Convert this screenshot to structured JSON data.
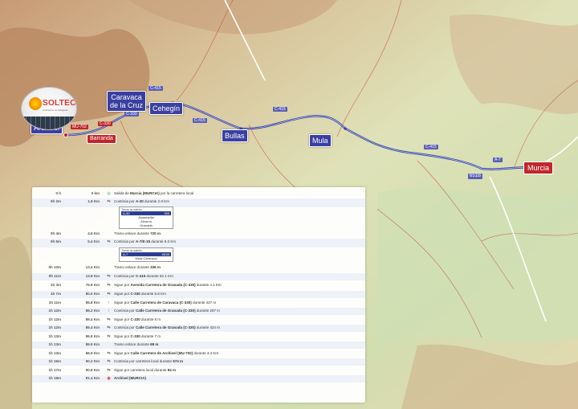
{
  "map": {
    "towns": {
      "caravaca": "Caravaca\nde la Cruz",
      "cehegin": "Cehegín",
      "bullas": "Bullas",
      "mula": "Mula",
      "murcia": "Murcia",
      "archivel": "Archivel",
      "barranda": "Barranda"
    },
    "roads": {
      "c415_a": "C-415",
      "c415_b": "C-415",
      "c415_c": "C-415",
      "c415_d": "C-415",
      "c330_a": "C-330",
      "c330_b": "C-330",
      "mu702": "MU-702",
      "a7": "A-7",
      "exit": "651B"
    },
    "colors": {
      "route": "#3340a0",
      "town_label": "#3a3fa0",
      "destination": "#c0262b"
    }
  },
  "logo": {
    "brand": "SOLTEC",
    "sub": "soluciones tecnológicas"
  },
  "itinerary": {
    "rows": [
      {
        "time": "0 h",
        "dist": "0 km",
        "icon": "start-icon",
        "glyph": "◎",
        "text": "Salida de ",
        "bold": "Murcia (MURCIA)",
        "text2": " por la carretera local"
      },
      {
        "time": "0h 2m",
        "dist": "1.8 Km",
        "icon": "turn-icon",
        "glyph": "⇆",
        "text": "Continúa por ",
        "bold": "A-30",
        "text2": " durante 2.8 Km"
      },
      {
        "time": "0h 4m",
        "dist": "4.6 Km",
        "icon": "none",
        "glyph": "",
        "text": "Tramo enlace durante ",
        "bold": "720 m",
        "text2": ""
      },
      {
        "time": "0h 5m",
        "dist": "5.4 Km",
        "icon": "turn-icon",
        "glyph": "⇆",
        "text": "Continúa por ",
        "bold": "A-7/E-15",
        "text2": " durante 8.0 Km"
      },
      {
        "time": "0h 10m",
        "dist": "13.4 Km",
        "icon": "none",
        "glyph": "",
        "text": "Tramo enlace durante ",
        "bold": "336 m",
        "text2": ""
      },
      {
        "time": "0h 11m",
        "dist": "13.8 Km",
        "icon": "turn-icon",
        "glyph": "⇆",
        "text": "Continúa por ",
        "bold": "C-415",
        "text2": " durante 62.1 Km"
      },
      {
        "time": "1h 3m",
        "dist": "75.9 Km",
        "icon": "turn-icon",
        "glyph": "⇆",
        "text": "Sigue por ",
        "bold": "Avenida Carretera de Granada (C-330)",
        "text2": " durante 4.1 Km"
      },
      {
        "time": "1h 7m",
        "dist": "80.0 Km",
        "icon": "turn-icon",
        "glyph": "⇆",
        "text": "Sigue por ",
        "bold": "C-330",
        "text2": " durante 5.8 Km"
      },
      {
        "time": "1h 11m",
        "dist": "85.8 Km",
        "icon": "straight-icon",
        "glyph": "↑",
        "text": "Sigue por ",
        "bold": "Calle Carretera de Caravaca (C-330)",
        "text2": " durante 427 m"
      },
      {
        "time": "1h 12m",
        "dist": "86.2 Km",
        "icon": "straight-icon",
        "glyph": "↑",
        "text": "Continúa por ",
        "bold": "Calle Carretera de Granada (C-330)",
        "text2": " durante 207 m"
      },
      {
        "time": "1h 12m",
        "dist": "86.4 Km",
        "icon": "turn-icon",
        "glyph": "⇆",
        "text": "Sigue por ",
        "bold": "C-330",
        "text2": " durante 8 m"
      },
      {
        "time": "1h 12m",
        "dist": "86.4 Km",
        "icon": "turn-icon",
        "glyph": "⇆",
        "text": "Continúa por ",
        "bold": "Calle Carretera de Granada (C-330)",
        "text2": " durante 424 m"
      },
      {
        "time": "1h 13m",
        "dist": "86.9 Km",
        "icon": "turn-icon",
        "glyph": "⇆",
        "text": "Sigue por ",
        "bold": "C-330",
        "text2": " durante 7 m"
      },
      {
        "time": "1h 13m",
        "dist": "86.9 Km",
        "icon": "none",
        "glyph": "",
        "text": "Tramo enlace durante ",
        "bold": "68 m",
        "text2": ""
      },
      {
        "time": "1h 13m",
        "dist": "86.9 Km",
        "icon": "turn-icon",
        "glyph": "⇆",
        "text": "Sigue por ",
        "bold": "Calle Carretera de Archivel (MU-702)",
        "text2": " durante 3.3 Km"
      },
      {
        "time": "1h 16m",
        "dist": "90.2 Km",
        "icon": "turn-icon",
        "glyph": "⇆",
        "text": "Continúa por carretera local durante ",
        "bold": "574 m",
        "text2": ""
      },
      {
        "time": "1h 17m",
        "dist": "90.8 Km",
        "icon": "turn-icon",
        "glyph": "⇆",
        "text": "Sigue por carretera local durante ",
        "bold": "94 m",
        "text2": ""
      },
      {
        "time": "1h 18m",
        "dist": "91.4 Km",
        "icon": "end-icon",
        "glyph": "◉",
        "text": "",
        "bold": "Archivel (MURCIA)",
        "text2": ""
      }
    ],
    "sign1": {
      "caption": "Toma la salida",
      "road": "A-30",
      "exit": "390",
      "dest1": "Alcantarilla",
      "dest2": "Almería",
      "dest3": "Granada"
    },
    "sign2": {
      "caption": "Toma la salida",
      "road": "A-7",
      "exit": "651B",
      "dest1": "Mula-Caravaca"
    }
  }
}
